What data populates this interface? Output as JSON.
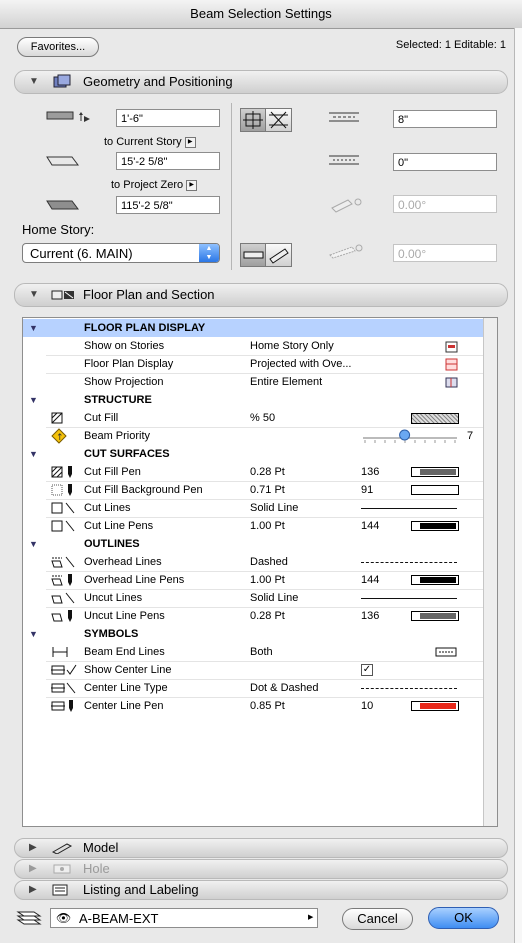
{
  "window": {
    "title": "Beam Selection Settings"
  },
  "header": {
    "favorites_label": "Favorites...",
    "selection_status": "Selected: 1 Editable: 1"
  },
  "geometry": {
    "section_label": "Geometry and Positioning",
    "height_value": "1'-6\"",
    "to_current_story_label": "to Current Story",
    "current_story_value": "15'-2 5/8\"",
    "to_project_zero_label": "to Project Zero",
    "project_zero_value": "115'-2 5/8\"",
    "home_story_label": "Home Story:",
    "home_story_value": "Current (6. MAIN)",
    "width_value": "8\"",
    "offset_value": "0\"",
    "slant_angle_value": "0.00°",
    "tilt_angle_value": "0.00°"
  },
  "floor_plan": {
    "section_label": "Floor Plan and Section",
    "groups": {
      "display": "FLOOR PLAN DISPLAY",
      "structure": "STRUCTURE",
      "cut_surfaces": "CUT SURFACES",
      "outlines": "OUTLINES",
      "symbols": "SYMBOLS"
    },
    "rows": {
      "show_on_stories": {
        "label": "Show on Stories",
        "value": "Home Story Only"
      },
      "floor_plan_display": {
        "label": "Floor Plan Display",
        "value": "Projected with Ove..."
      },
      "show_projection": {
        "label": "Show Projection",
        "value": "Entire Element"
      },
      "cut_fill": {
        "label": "Cut Fill",
        "value": "%  50"
      },
      "beam_priority": {
        "label": "Beam Priority",
        "value": "7",
        "level": 0.6
      },
      "cut_fill_pen": {
        "label": "Cut Fill Pen",
        "value": "0.28 Pt",
        "pen": "136"
      },
      "cut_fill_bg_pen": {
        "label": "Cut Fill Background Pen",
        "value": "0.71 Pt",
        "pen": "91"
      },
      "cut_lines": {
        "label": "Cut Lines",
        "value": "Solid Line"
      },
      "cut_line_pens": {
        "label": "Cut Line Pens",
        "value": "1.00 Pt",
        "pen": "144"
      },
      "overhead_lines": {
        "label": "Overhead Lines",
        "value": "Dashed"
      },
      "overhead_line_pens": {
        "label": "Overhead Line Pens",
        "value": "1.00 Pt",
        "pen": "144"
      },
      "uncut_lines": {
        "label": "Uncut Lines",
        "value": "Solid Line"
      },
      "uncut_line_pens": {
        "label": "Uncut Line Pens",
        "value": "0.28 Pt",
        "pen": "136"
      },
      "beam_end_lines": {
        "label": "Beam End Lines",
        "value": "Both"
      },
      "show_center_line": {
        "label": "Show Center Line",
        "checked": true
      },
      "center_line_type": {
        "label": "Center Line Type",
        "value": "Dot & Dashed"
      },
      "center_line_pen": {
        "label": "Center Line Pen",
        "value": "0.85 Pt",
        "pen": "10"
      }
    }
  },
  "collapsed_sections": {
    "model": "Model",
    "hole": "Hole",
    "listing": "Listing and Labeling"
  },
  "footer": {
    "layer_value": "A-BEAM-EXT",
    "cancel_label": "Cancel",
    "ok_label": "OK"
  },
  "colors": {
    "selection": "#b7d2ff",
    "ok_button": "#3f8df2",
    "center_pen": "#e8281a"
  }
}
